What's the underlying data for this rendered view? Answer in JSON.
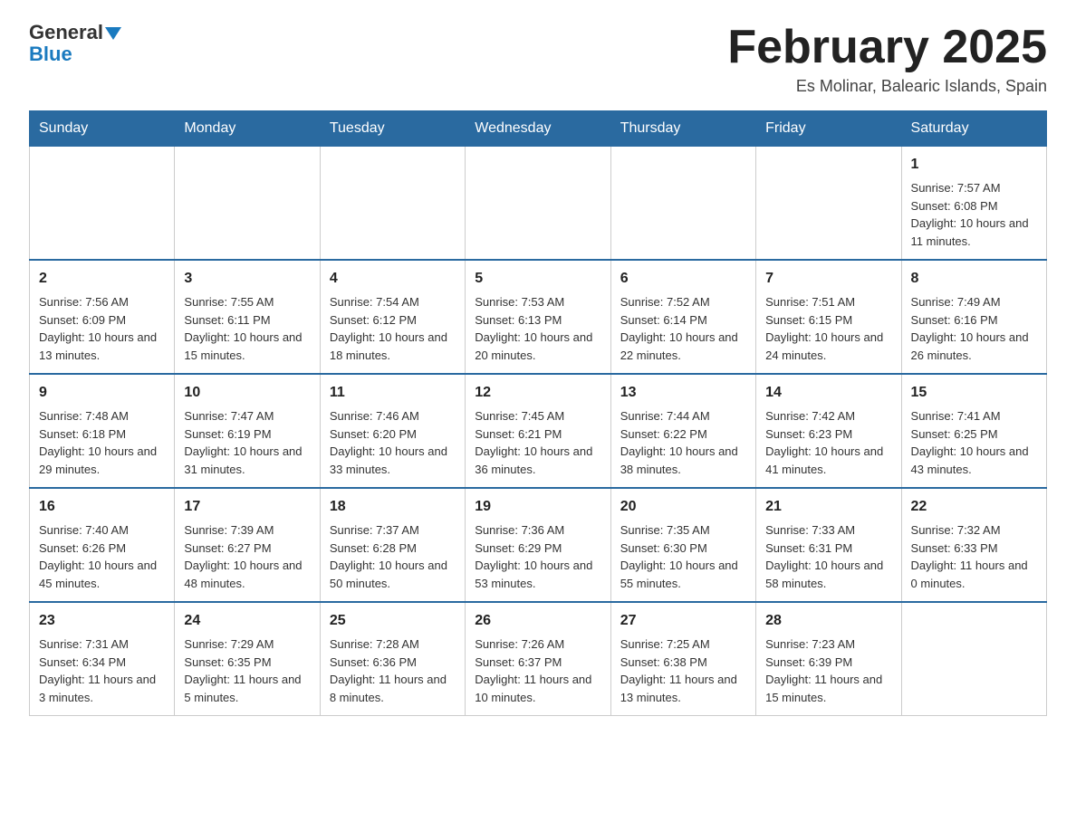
{
  "header": {
    "logo_line1": "General",
    "logo_line2": "Blue",
    "title": "February 2025",
    "subtitle": "Es Molinar, Balearic Islands, Spain"
  },
  "days_of_week": [
    "Sunday",
    "Monday",
    "Tuesday",
    "Wednesday",
    "Thursday",
    "Friday",
    "Saturday"
  ],
  "weeks": [
    {
      "cells": [
        {
          "day": "",
          "info": ""
        },
        {
          "day": "",
          "info": ""
        },
        {
          "day": "",
          "info": ""
        },
        {
          "day": "",
          "info": ""
        },
        {
          "day": "",
          "info": ""
        },
        {
          "day": "",
          "info": ""
        },
        {
          "day": "1",
          "info": "Sunrise: 7:57 AM\nSunset: 6:08 PM\nDaylight: 10 hours and 11 minutes."
        }
      ]
    },
    {
      "cells": [
        {
          "day": "2",
          "info": "Sunrise: 7:56 AM\nSunset: 6:09 PM\nDaylight: 10 hours and 13 minutes."
        },
        {
          "day": "3",
          "info": "Sunrise: 7:55 AM\nSunset: 6:11 PM\nDaylight: 10 hours and 15 minutes."
        },
        {
          "day": "4",
          "info": "Sunrise: 7:54 AM\nSunset: 6:12 PM\nDaylight: 10 hours and 18 minutes."
        },
        {
          "day": "5",
          "info": "Sunrise: 7:53 AM\nSunset: 6:13 PM\nDaylight: 10 hours and 20 minutes."
        },
        {
          "day": "6",
          "info": "Sunrise: 7:52 AM\nSunset: 6:14 PM\nDaylight: 10 hours and 22 minutes."
        },
        {
          "day": "7",
          "info": "Sunrise: 7:51 AM\nSunset: 6:15 PM\nDaylight: 10 hours and 24 minutes."
        },
        {
          "day": "8",
          "info": "Sunrise: 7:49 AM\nSunset: 6:16 PM\nDaylight: 10 hours and 26 minutes."
        }
      ]
    },
    {
      "cells": [
        {
          "day": "9",
          "info": "Sunrise: 7:48 AM\nSunset: 6:18 PM\nDaylight: 10 hours and 29 minutes."
        },
        {
          "day": "10",
          "info": "Sunrise: 7:47 AM\nSunset: 6:19 PM\nDaylight: 10 hours and 31 minutes."
        },
        {
          "day": "11",
          "info": "Sunrise: 7:46 AM\nSunset: 6:20 PM\nDaylight: 10 hours and 33 minutes."
        },
        {
          "day": "12",
          "info": "Sunrise: 7:45 AM\nSunset: 6:21 PM\nDaylight: 10 hours and 36 minutes."
        },
        {
          "day": "13",
          "info": "Sunrise: 7:44 AM\nSunset: 6:22 PM\nDaylight: 10 hours and 38 minutes."
        },
        {
          "day": "14",
          "info": "Sunrise: 7:42 AM\nSunset: 6:23 PM\nDaylight: 10 hours and 41 minutes."
        },
        {
          "day": "15",
          "info": "Sunrise: 7:41 AM\nSunset: 6:25 PM\nDaylight: 10 hours and 43 minutes."
        }
      ]
    },
    {
      "cells": [
        {
          "day": "16",
          "info": "Sunrise: 7:40 AM\nSunset: 6:26 PM\nDaylight: 10 hours and 45 minutes."
        },
        {
          "day": "17",
          "info": "Sunrise: 7:39 AM\nSunset: 6:27 PM\nDaylight: 10 hours and 48 minutes."
        },
        {
          "day": "18",
          "info": "Sunrise: 7:37 AM\nSunset: 6:28 PM\nDaylight: 10 hours and 50 minutes."
        },
        {
          "day": "19",
          "info": "Sunrise: 7:36 AM\nSunset: 6:29 PM\nDaylight: 10 hours and 53 minutes."
        },
        {
          "day": "20",
          "info": "Sunrise: 7:35 AM\nSunset: 6:30 PM\nDaylight: 10 hours and 55 minutes."
        },
        {
          "day": "21",
          "info": "Sunrise: 7:33 AM\nSunset: 6:31 PM\nDaylight: 10 hours and 58 minutes."
        },
        {
          "day": "22",
          "info": "Sunrise: 7:32 AM\nSunset: 6:33 PM\nDaylight: 11 hours and 0 minutes."
        }
      ]
    },
    {
      "cells": [
        {
          "day": "23",
          "info": "Sunrise: 7:31 AM\nSunset: 6:34 PM\nDaylight: 11 hours and 3 minutes."
        },
        {
          "day": "24",
          "info": "Sunrise: 7:29 AM\nSunset: 6:35 PM\nDaylight: 11 hours and 5 minutes."
        },
        {
          "day": "25",
          "info": "Sunrise: 7:28 AM\nSunset: 6:36 PM\nDaylight: 11 hours and 8 minutes."
        },
        {
          "day": "26",
          "info": "Sunrise: 7:26 AM\nSunset: 6:37 PM\nDaylight: 11 hours and 10 minutes."
        },
        {
          "day": "27",
          "info": "Sunrise: 7:25 AM\nSunset: 6:38 PM\nDaylight: 11 hours and 13 minutes."
        },
        {
          "day": "28",
          "info": "Sunrise: 7:23 AM\nSunset: 6:39 PM\nDaylight: 11 hours and 15 minutes."
        },
        {
          "day": "",
          "info": ""
        }
      ]
    }
  ]
}
